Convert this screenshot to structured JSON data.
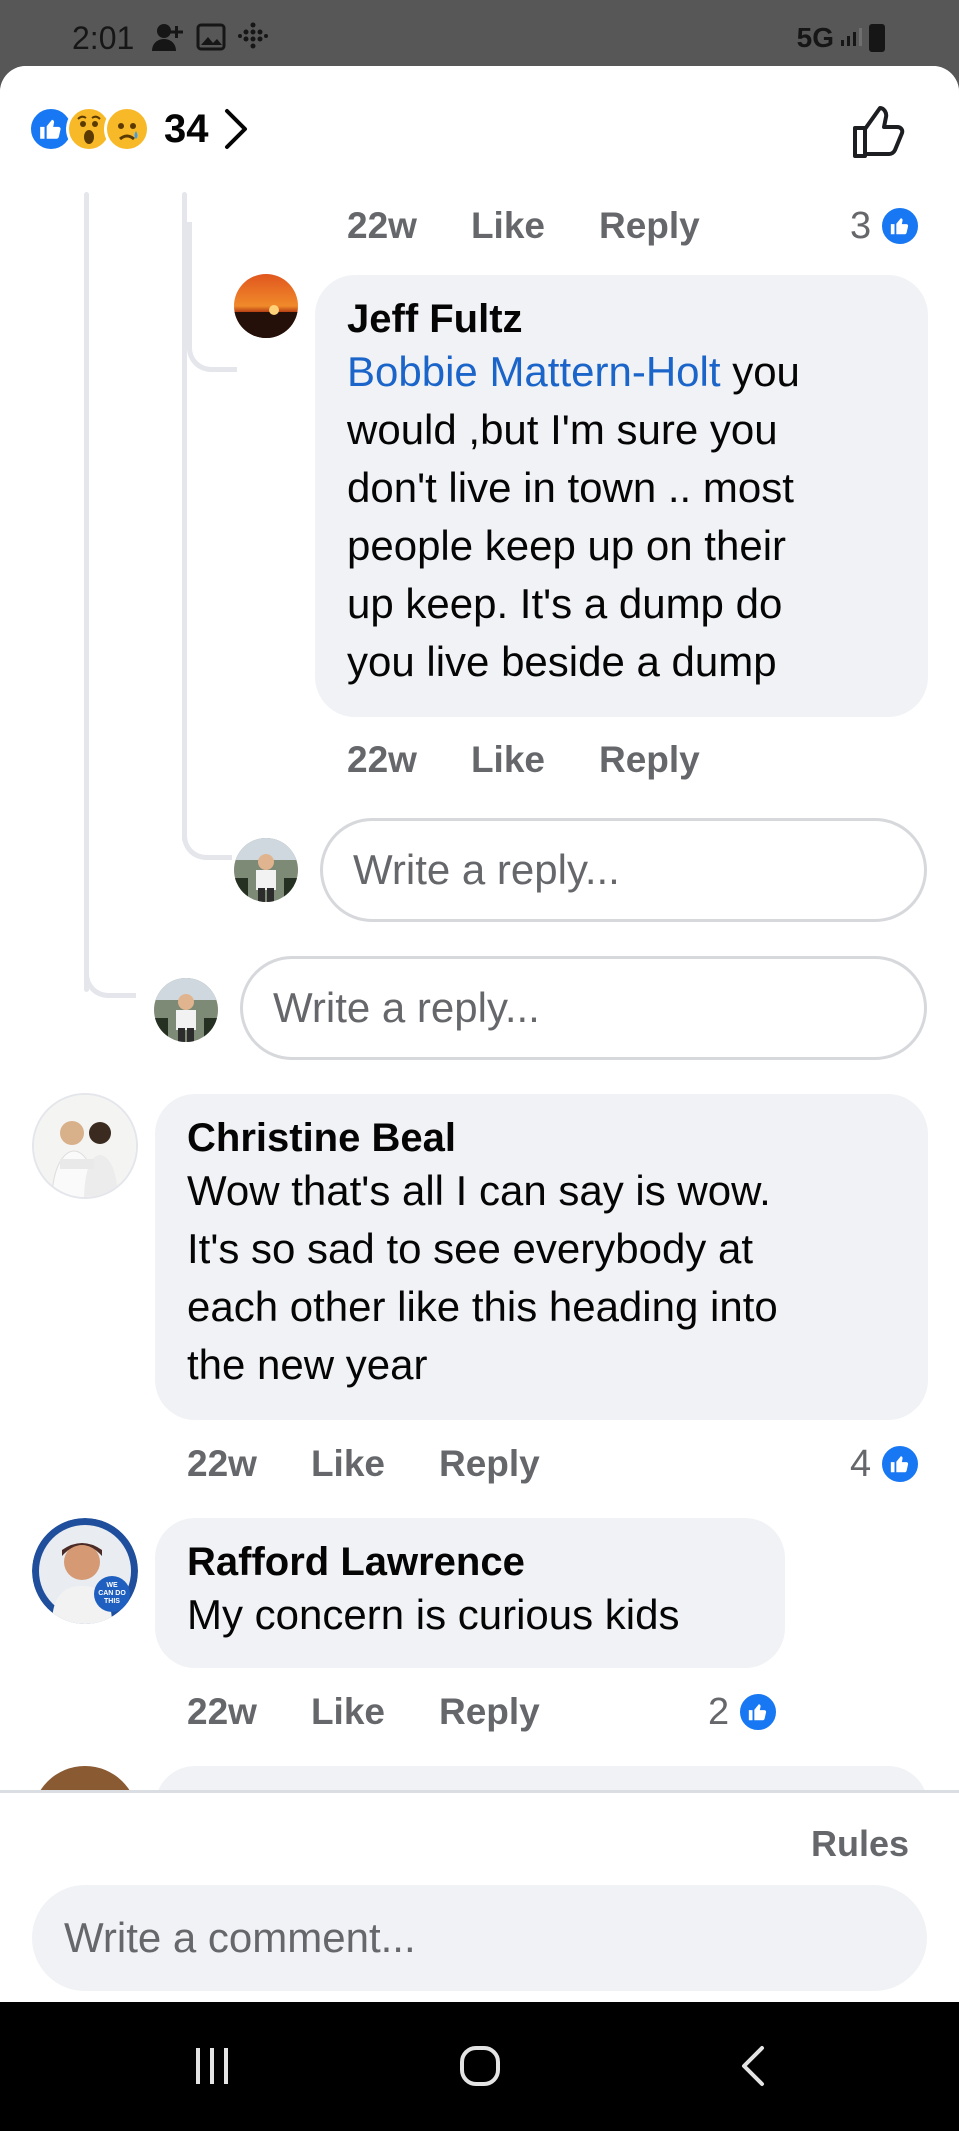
{
  "status_bar": {
    "time": "2:01",
    "network": "5G"
  },
  "header": {
    "reaction_count": "34"
  },
  "comments": [
    {
      "time": "22w",
      "like_label": "Like",
      "reply_label": "Reply",
      "likes": "3"
    },
    {
      "author": "Jeff Fultz",
      "mention": "Bobbie Mattern-Holt",
      "text_lines": [
        "you",
        "would  ,but I'm sure you",
        "don't live in town .. most",
        "people keep up on their",
        "up keep. It's a dump do",
        "you live beside a dump"
      ],
      "time": "22w",
      "like_label": "Like",
      "reply_label": "Reply"
    },
    {
      "author": "Christine Beal",
      "text_lines": [
        "Wow that's all I can say is wow.",
        "It's so sad to see everybody at",
        "each other like this heading into",
        "the new year"
      ],
      "time": "22w",
      "like_label": "Like",
      "reply_label": "Reply",
      "likes": "4"
    },
    {
      "author": "Rafford Lawrence",
      "text_lines": [
        "My concern is curious kids"
      ],
      "time": "22w",
      "like_label": "Like",
      "reply_label": "Reply",
      "likes": "2"
    }
  ],
  "reply_placeholder": "Write a reply...",
  "composer": {
    "rules_label": "Rules",
    "placeholder": "Write a comment..."
  },
  "avatar_badge_text": "WE CAN DO THIS",
  "colors": {
    "accent": "#1877f2",
    "mention": "#1b64c9",
    "bubble": "#f0f2f5",
    "muted": "#65676b"
  },
  "icons": [
    "like-reaction-icon",
    "wow-reaction-icon",
    "sad-reaction-icon",
    "chevron-right-icon",
    "thumbs-up-icon",
    "recents-icon",
    "home-icon",
    "back-icon"
  ]
}
